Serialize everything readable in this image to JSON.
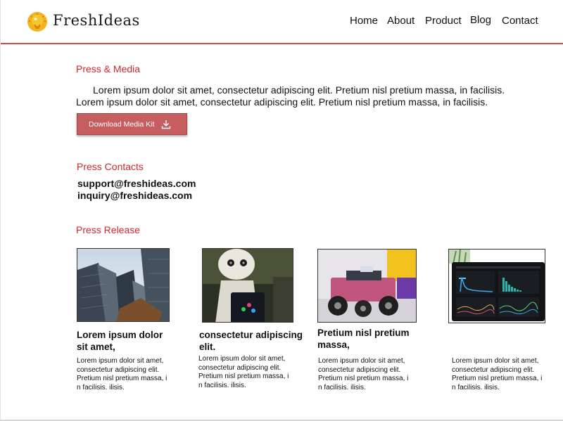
{
  "header": {
    "brand": "FreshIdeas",
    "nav": [
      "Home",
      "About",
      "Product",
      "Blog",
      "Contact"
    ]
  },
  "press_media": {
    "title": "Press & Media",
    "intro": "Lorem ipsum dolor sit amet, consectetur adipiscing elit. Pretium nisl pretium massa, in facilisis. Lorem ipsum dolor sit  amet, consectetur adipiscing elit. Pretium nisl pretium massa, in facilisis.",
    "download_label": "Download Media Kit"
  },
  "press_contacts": {
    "title": "Press Contacts",
    "emails": [
      "support@freshideas.com",
      "inquiry@freshideas.com"
    ]
  },
  "press_release": {
    "title": "Press Release",
    "cards": [
      {
        "title_line1": "Lorem ipsum dolor",
        "title_line2": "sit amet,",
        "body": [
          "Lorem ipsum dolor sit amet,",
          "consectetur adipiscing elit.",
          " Pretium nisl pretium massa, i",
          "n facilisis. ilisis."
        ]
      },
      {
        "title_line1": "consectetur adipiscing",
        "title_line2": "elit.",
        "body": [
          "Lorem ipsum dolor sit amet,",
          "consectetur adipiscing elit.",
          " Pretium nisl pretium massa, i",
          "n facilisis. ilisis."
        ]
      },
      {
        "title_line1": "Pretium nisl pretium",
        "title_line2": "massa,",
        "body": [
          "Lorem ipsum dolor sit amet,",
          "consectetur adipiscing elit.",
          " Pretium nisl pretium massa, i",
          "n facilisis. ilisis."
        ]
      },
      {
        "title_line1": "",
        "title_line2": "",
        "body": [
          "Lorem ipsum dolor sit amet,",
          "consectetur adipiscing elit.",
          " Pretium nisl pretium massa, i",
          "n facilisis. ilisis."
        ]
      }
    ]
  },
  "colors": {
    "accent": "#d0272f",
    "button": "#c65d5e",
    "header_line": "#c9504d"
  },
  "icons": {
    "logo": "lightbulb-icon",
    "download": "download-icon"
  }
}
